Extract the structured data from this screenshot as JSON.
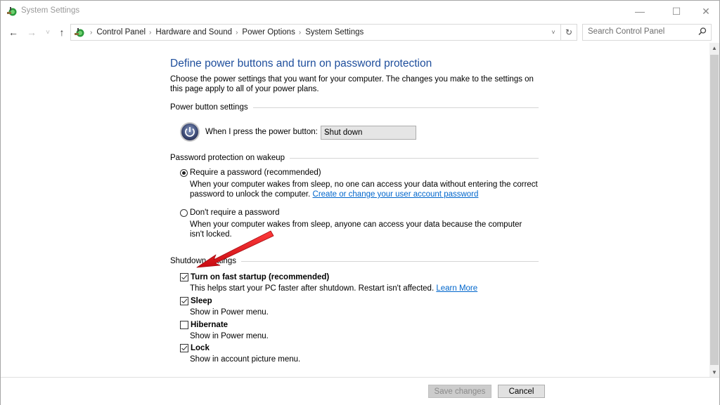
{
  "window": {
    "title": "System Settings",
    "controls": {
      "minimize": "—",
      "maximize": "☐",
      "close": "✕"
    }
  },
  "navigation": {
    "back_icon": "←",
    "forward_icon": "→",
    "recent_icon": "˅",
    "up_icon": "↑",
    "breadcrumb": [
      "Control Panel",
      "Hardware and Sound",
      "Power Options",
      "System Settings"
    ],
    "breadcrumb_separator": "›",
    "dropdown_icon": "˅",
    "refresh_icon": "↻"
  },
  "search": {
    "placeholder": "Search Control Panel",
    "value": ""
  },
  "page": {
    "title": "Define power buttons and turn on password protection",
    "intro": "Choose the power settings that you want for your computer. The changes you make to the settings on this page apply to all of your power plans.",
    "power_button_section": {
      "heading": "Power button settings",
      "label": "When I press the power button:",
      "selected": "Shut down"
    },
    "password_section": {
      "heading": "Password protection on wakeup",
      "options": [
        {
          "label": "Require a password (recommended)",
          "selected": true,
          "description": "When your computer wakes from sleep, no one can access your data without entering the correct password to unlock the computer.",
          "link": "Create or change your user account password"
        },
        {
          "label": "Don't require a password",
          "selected": false,
          "description": "When your computer wakes from sleep, anyone can access your data because the computer isn't locked.",
          "link": ""
        }
      ]
    },
    "shutdown_section": {
      "heading": "Shutdown settings",
      "options": [
        {
          "label": "Turn on fast startup (recommended)",
          "checked": true,
          "description": "This helps start your PC faster after shutdown. Restart isn't affected.",
          "link": "Learn More"
        },
        {
          "label": "Sleep",
          "checked": true,
          "description": "Show in Power menu.",
          "link": ""
        },
        {
          "label": "Hibernate",
          "checked": false,
          "description": "Show in Power menu.",
          "link": ""
        },
        {
          "label": "Lock",
          "checked": true,
          "description": "Show in account picture menu.",
          "link": ""
        }
      ]
    }
  },
  "footer": {
    "save_label": "Save changes",
    "save_enabled": false,
    "cancel_label": "Cancel"
  },
  "annotation": {
    "arrow_color": "#e8141b",
    "points_to": "Turn on fast startup (recommended)"
  },
  "colors": {
    "title_blue": "#1e4e9c",
    "link_blue": "#0066cc"
  }
}
